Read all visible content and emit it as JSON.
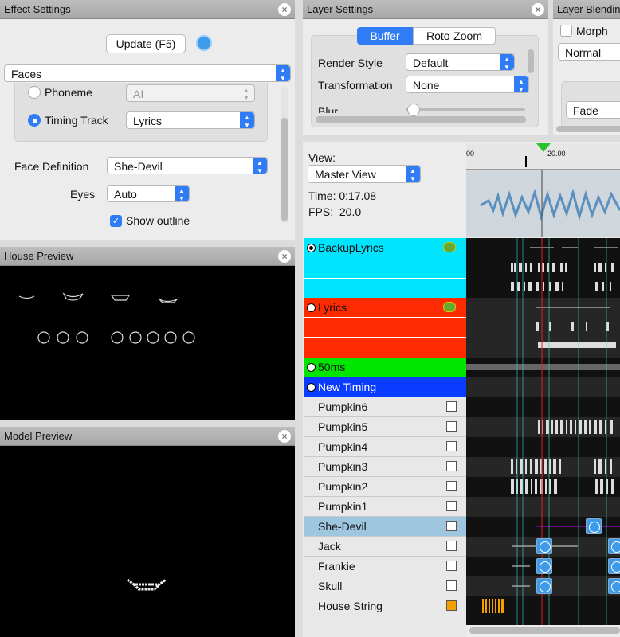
{
  "effect_settings": {
    "title": "Effect Settings",
    "update_button": "Update (F5)",
    "effect_select": "Faces",
    "phoneme_label": "Phoneme",
    "phoneme_value": "AI",
    "timing_track_label": "Timing Track",
    "timing_track_value": "Lyrics",
    "face_definition_label": "Face Definition",
    "face_definition_value": "She-Devil",
    "eyes_label": "Eyes",
    "eyes_value": "Auto",
    "show_outline_label": "Show outline"
  },
  "layer_settings": {
    "title": "Layer Settings",
    "tab_buffer": "Buffer",
    "tab_rotozoom": "Roto-Zoom",
    "render_style_label": "Render Style",
    "render_style_value": "Default",
    "transformation_label": "Transformation",
    "transformation_value": "None",
    "blur_label": "Blur"
  },
  "layer_blending": {
    "title": "Layer Blendin",
    "morph_label": "Morph",
    "mode_value": "Normal",
    "fade_value": "Fade"
  },
  "house_preview": {
    "title": "House Preview"
  },
  "model_preview": {
    "title": "Model Preview"
  },
  "sequencer": {
    "view_label": "View:",
    "view_value": "Master View",
    "time_text": "Time: 0:17.08",
    "fps_text": "FPS:  20.0",
    "ruler_labels": [
      "00",
      "20.00"
    ],
    "timing_rows": [
      {
        "name": "BackupLyrics",
        "color": "#00e5ff"
      },
      {
        "name": "Lyrics",
        "color": "#ff2b00"
      },
      {
        "name": "50ms",
        "color": "#00e600"
      },
      {
        "name": "New Timing",
        "color": "#0a3cff"
      }
    ],
    "models": [
      "Pumpkin6",
      "Pumpkin5",
      "Pumpkin4",
      "Pumpkin3",
      "Pumpkin2",
      "Pumpkin1",
      "She-Devil",
      "Jack",
      "Frankie",
      "Skull",
      "House String"
    ]
  }
}
